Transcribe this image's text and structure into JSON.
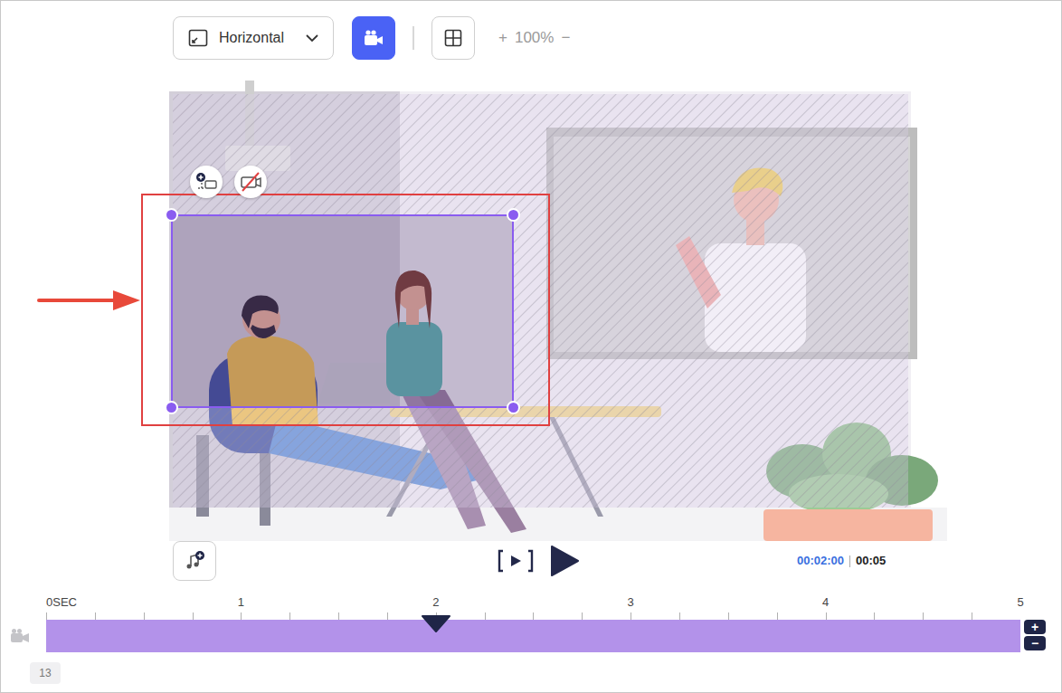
{
  "toolbar": {
    "aspect": {
      "label": "Horizontal"
    },
    "camera_mode": {
      "active": true
    },
    "zoom": {
      "plus": "+",
      "value": "100%",
      "minus": "−"
    }
  },
  "canvas": {
    "camera_frame": {
      "selected": true,
      "highlighted": true
    }
  },
  "playback": {
    "current": "00:02:00",
    "total": "00:05"
  },
  "timeline": {
    "ticks": [
      "0SEC",
      "1",
      "2",
      "3",
      "4",
      "5"
    ],
    "playhead": 0.4,
    "zoom_in": "+",
    "zoom_out": "−"
  },
  "track": {
    "count": "13"
  }
}
